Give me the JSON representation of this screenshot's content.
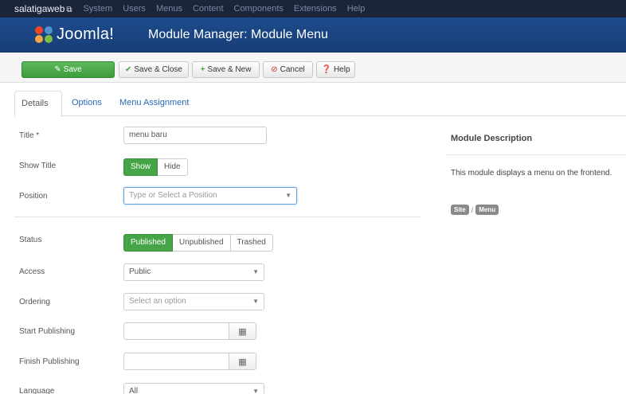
{
  "topbar": {
    "site_name": "salatigaweb",
    "site_ext": "⧉",
    "menus": [
      "System",
      "Users",
      "Menus",
      "Content",
      "Components",
      "Extensions",
      "Help"
    ]
  },
  "header": {
    "logo_text": "Joomla!",
    "title": "Module Manager: Module Menu"
  },
  "toolbar": {
    "save": "Save",
    "save_close": "Save & Close",
    "save_new": "Save & New",
    "cancel": "Cancel",
    "help": "Help"
  },
  "tabs": [
    "Details",
    "Options",
    "Menu Assignment"
  ],
  "form": {
    "title_label": "Title *",
    "title_value": "menu baru",
    "show_title_label": "Show Title",
    "show_title_options": [
      "Show",
      "Hide"
    ],
    "position_label": "Position",
    "position_placeholder": "Type or Select a Position",
    "status_label": "Status",
    "status_options": [
      "Published",
      "Unpublished",
      "Trashed"
    ],
    "access_label": "Access",
    "access_value": "Public",
    "ordering_label": "Ordering",
    "ordering_placeholder": "Select an option",
    "start_label": "Start Publishing",
    "finish_label": "Finish Publishing",
    "language_label": "Language",
    "language_value": "All"
  },
  "sidebar": {
    "title": "Module Description",
    "text": "This module displays a menu on the frontend.",
    "badge_site": "Site",
    "separator": "/",
    "badge_menu": "Menu"
  },
  "colors": {
    "topbar": "#1b2438",
    "header": "#1d4b8c",
    "save_green": "#5cb85c",
    "toggle_green": "#46a546",
    "link_blue": "#2a69b8"
  }
}
